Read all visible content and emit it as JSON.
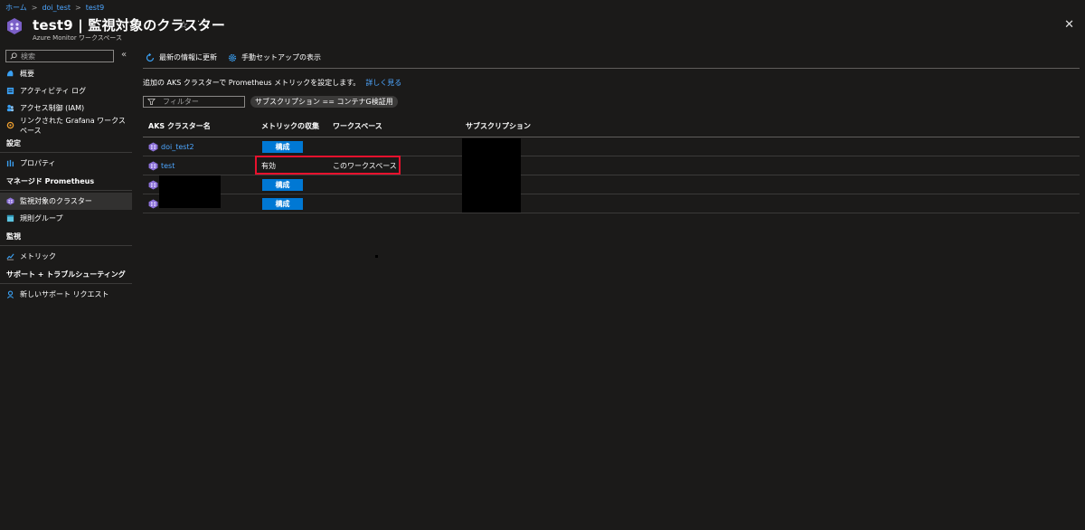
{
  "breadcrumb": [
    "ホーム",
    "doi_test",
    "test9"
  ],
  "header": {
    "title": "test9 | 監視対象のクラスター",
    "subtitle": "Azure Monitor ワークスペース"
  },
  "sidebar": {
    "search_placeholder": "検索",
    "items": [
      {
        "label": "概要"
      },
      {
        "label": "アクティビティ ログ"
      },
      {
        "label": "アクセス制御 (IAM)"
      },
      {
        "label": "リンクされた Grafana ワークスペース"
      }
    ],
    "sections": [
      {
        "title": "設定",
        "items": [
          {
            "label": "プロパティ"
          }
        ]
      },
      {
        "title": "マネージド Prometheus",
        "items": [
          {
            "label": "監視対象のクラスター"
          },
          {
            "label": "規則グループ"
          }
        ]
      },
      {
        "title": "監視",
        "items": [
          {
            "label": "メトリック"
          }
        ]
      },
      {
        "title": "サポート + トラブルシューティング",
        "items": [
          {
            "label": "新しいサポート リクエスト"
          }
        ]
      }
    ]
  },
  "toolbar": {
    "refresh_label": "最新の情報に更新",
    "manual_setup_label": "手動セットアップの表示"
  },
  "description": {
    "text": "追加の AKS クラスターで Prometheus メトリックを設定します。",
    "link": "詳しく見る"
  },
  "filter": {
    "placeholder": "フィルター",
    "pill": "サブスクリプション == コンテナG検証用"
  },
  "table": {
    "headers": [
      "AKS クラスター名",
      "メトリックの収集",
      "ワークスペース",
      "サブスクリプション"
    ],
    "rows": [
      {
        "name": "doi_test2",
        "collection_button": "構成",
        "workspace": ""
      },
      {
        "name": "test",
        "collection": "有効",
        "workspace": "このワークスペース"
      },
      {
        "name": "",
        "collection_button": "構成",
        "workspace": ""
      },
      {
        "name": "",
        "collection_button": "構成",
        "workspace": ""
      }
    ]
  },
  "colors": {
    "background": "#1b1a19",
    "accent": "#0078d4",
    "link": "#4da6ff",
    "highlight": "#e8112d"
  }
}
